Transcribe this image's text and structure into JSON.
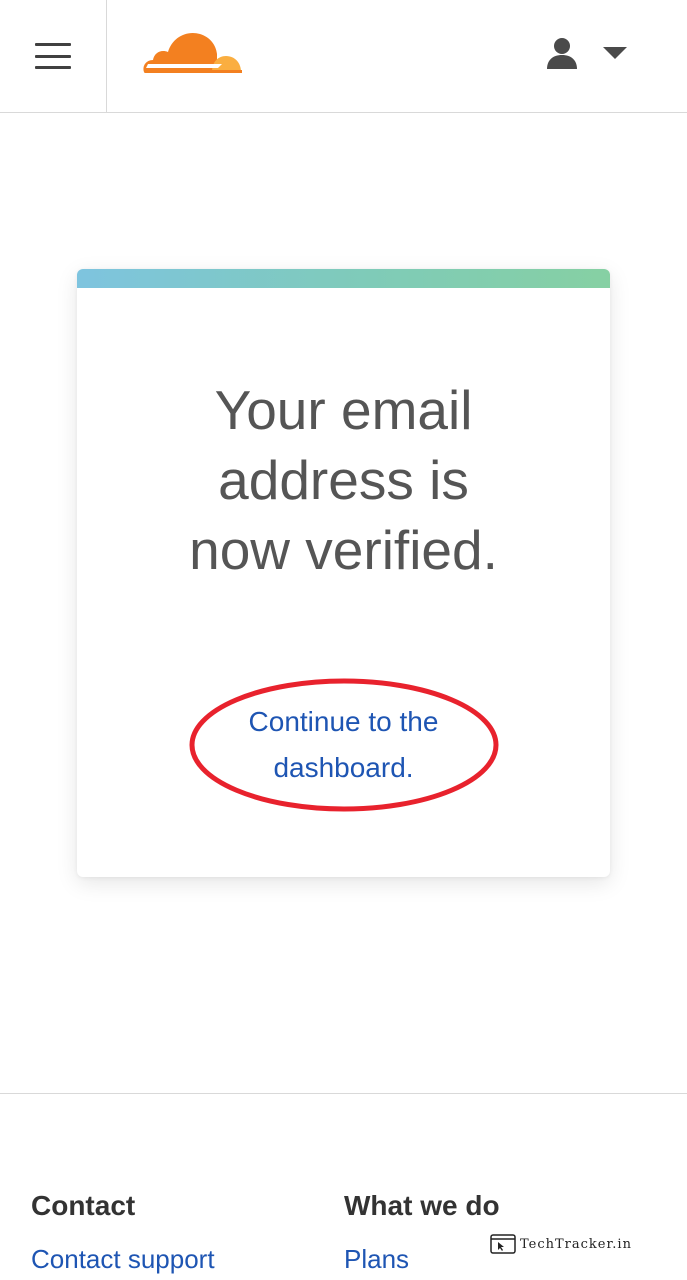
{
  "header": {
    "menu_icon": "hamburger-menu-icon",
    "logo_icon": "cloudflare-cloud-logo",
    "user_icon": "user-icon",
    "caret_icon": "caret-down-icon",
    "colors": {
      "logo_orange": "#f38020",
      "logo_light_orange": "#faae40",
      "icon_gray": "#4a4a4a"
    }
  },
  "card": {
    "title": "Your email address is now verified.",
    "link_label": "Continue to the dashboard.",
    "colors": {
      "title": "#555555",
      "link": "#1e55b3",
      "highlight": "#e8222d"
    }
  },
  "footer": {
    "contact": {
      "heading": "Contact",
      "links": [
        "Contact support"
      ]
    },
    "what_we_do": {
      "heading": "What we do",
      "links": [
        "Plans"
      ]
    }
  },
  "watermark": {
    "text": "TechTracker.in"
  }
}
